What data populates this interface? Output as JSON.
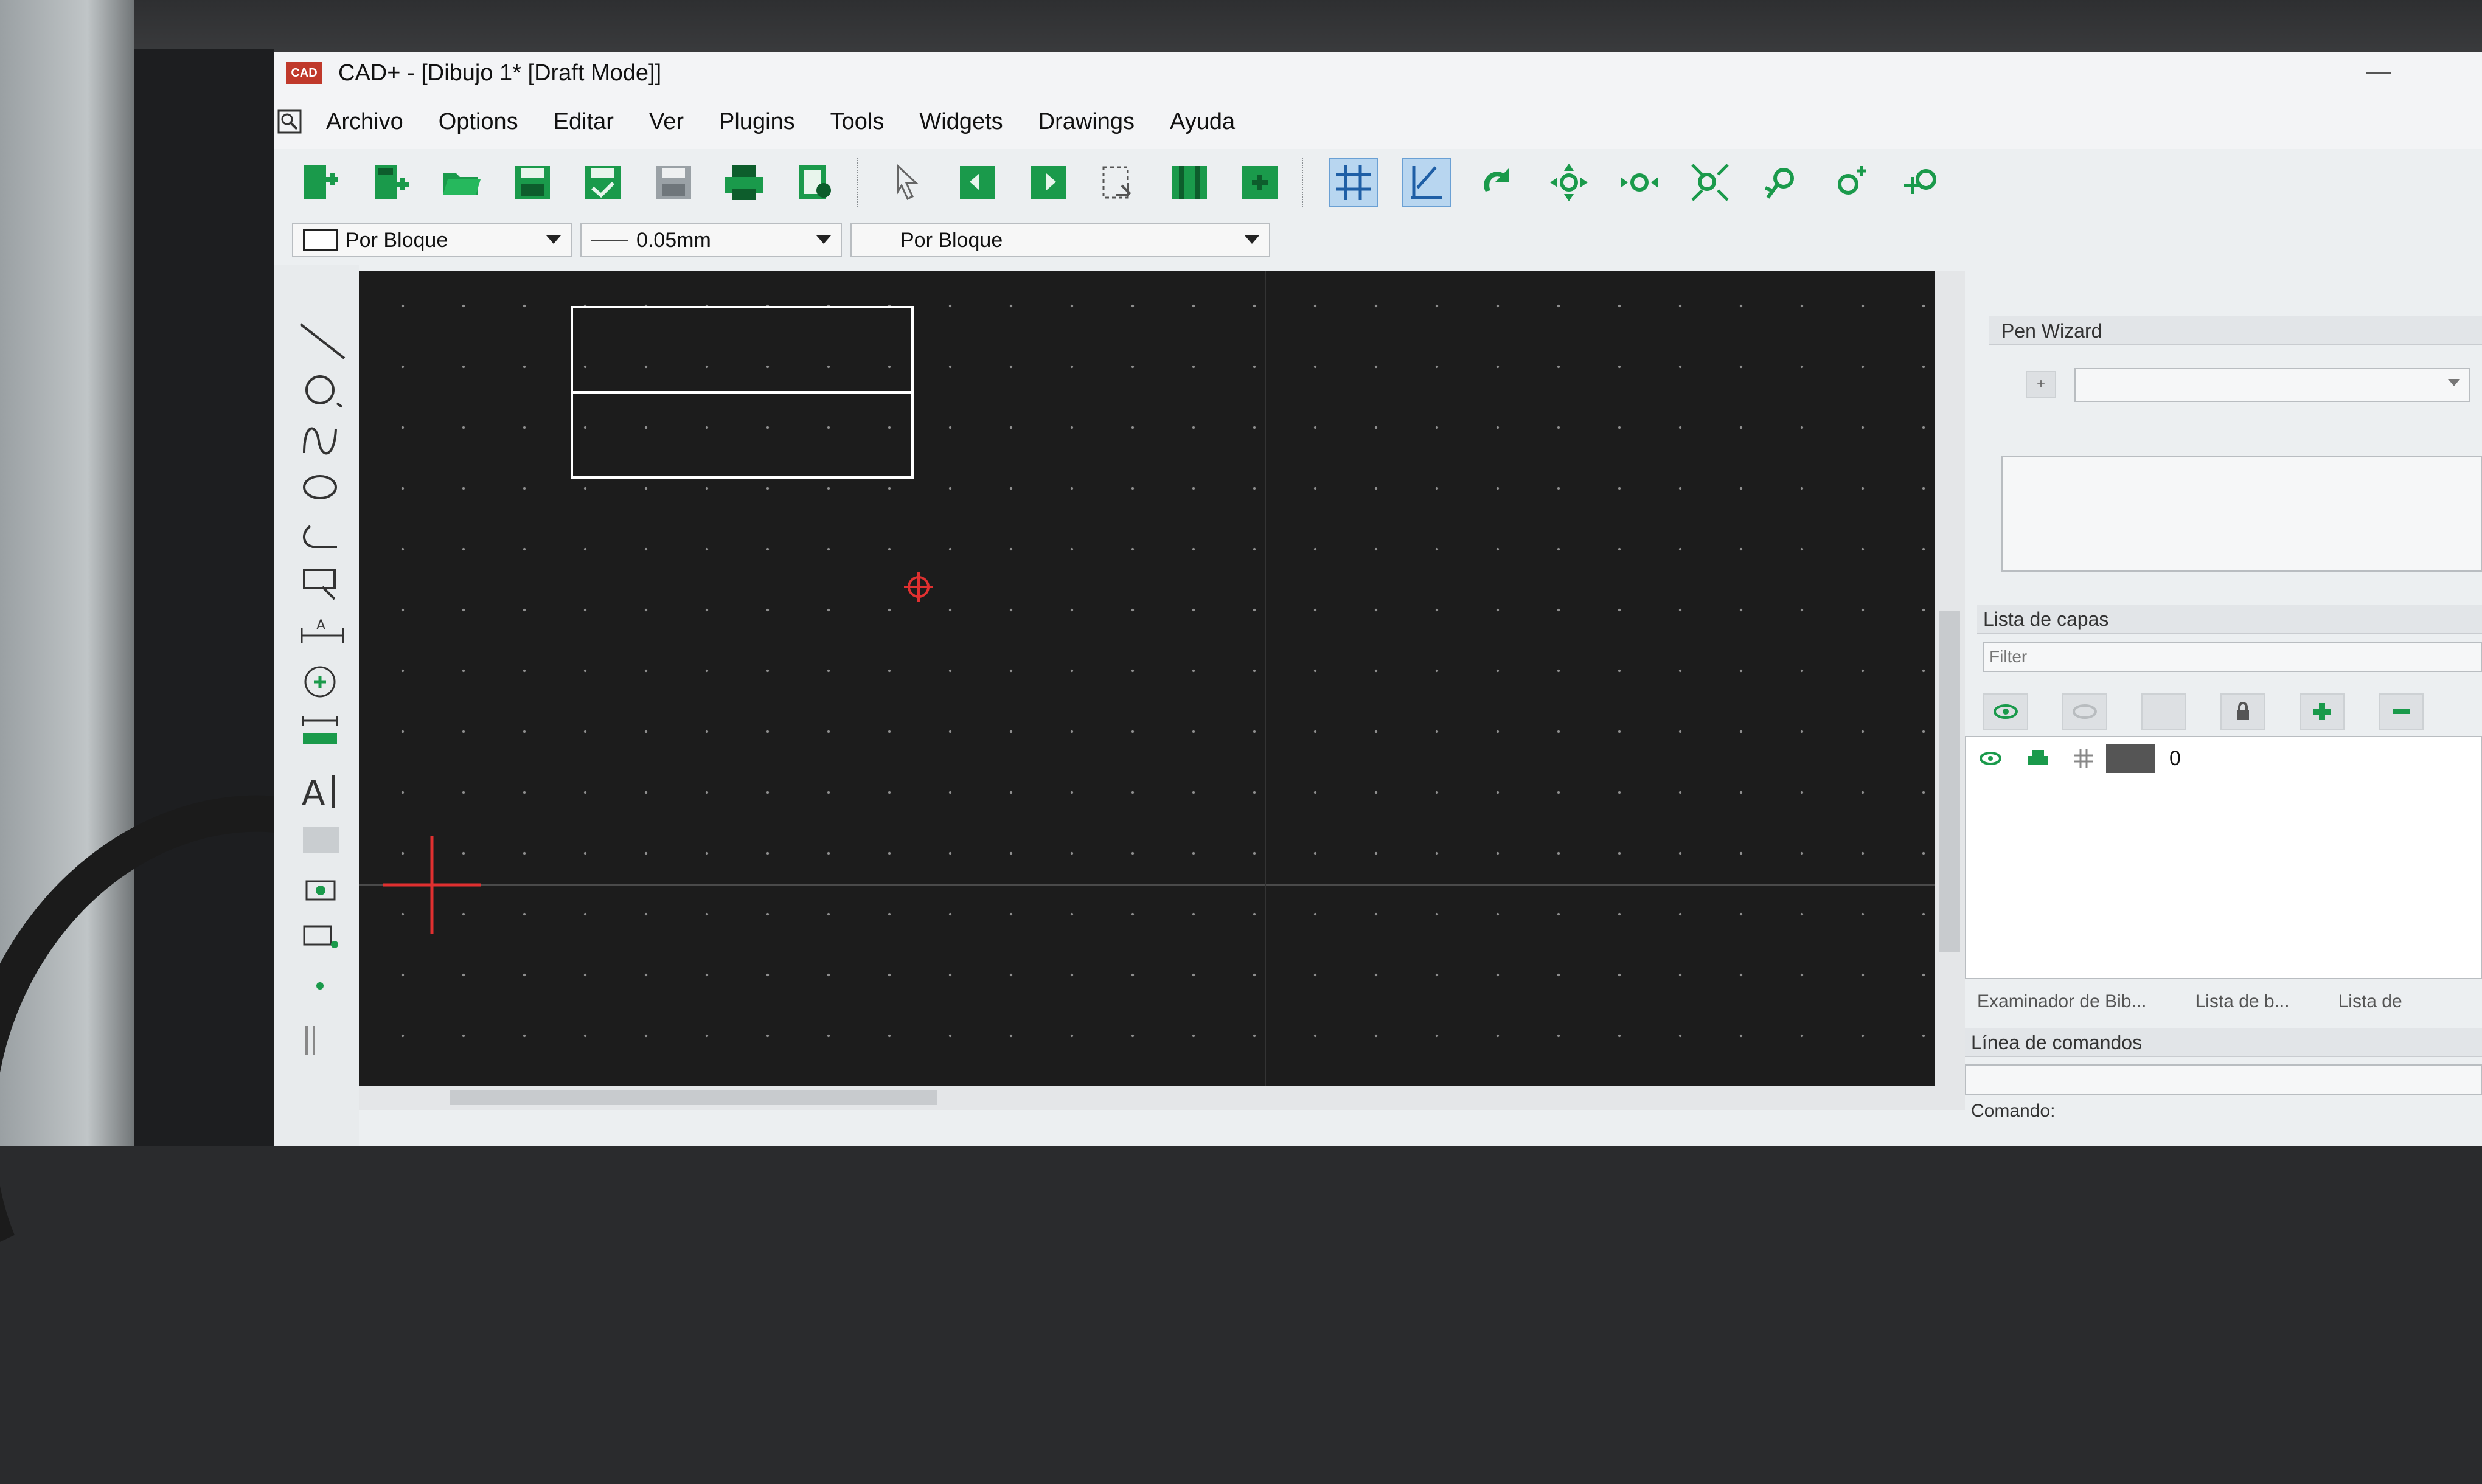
{
  "window": {
    "app_icon_label": "CAD",
    "title": "CAD+ - [Dibujo 1* [Draft Mode]]"
  },
  "menu": [
    "Archivo",
    "Options",
    "Editar",
    "Ver",
    "Plugins",
    "Tools",
    "Widgets",
    "Drawings",
    "Ayuda"
  ],
  "properties": {
    "color": "Por Bloque",
    "width": "0.05mm",
    "linetype": "Por Bloque"
  },
  "dock": {
    "pen_wizard_title": "Pen Wizard",
    "pen_wizard_add": "+",
    "layers_title": "Lista de capas",
    "layers_filter_placeholder": "Filter",
    "layers": [
      {
        "name": "0",
        "visible": true
      }
    ],
    "bottom_tabs": [
      "Examinador de Bib...",
      "Lista de b...",
      "Lista de"
    ],
    "command_title": "Línea de comandos",
    "command_prompt": "Comando:"
  },
  "colors": {
    "canvas_bg": "#1c1c1c",
    "grid_dot": "#8f8f8f",
    "toolbar_icon": "#1a9a4b",
    "accent_red": "#e03030",
    "active_toggle": "#b8d6f0"
  }
}
